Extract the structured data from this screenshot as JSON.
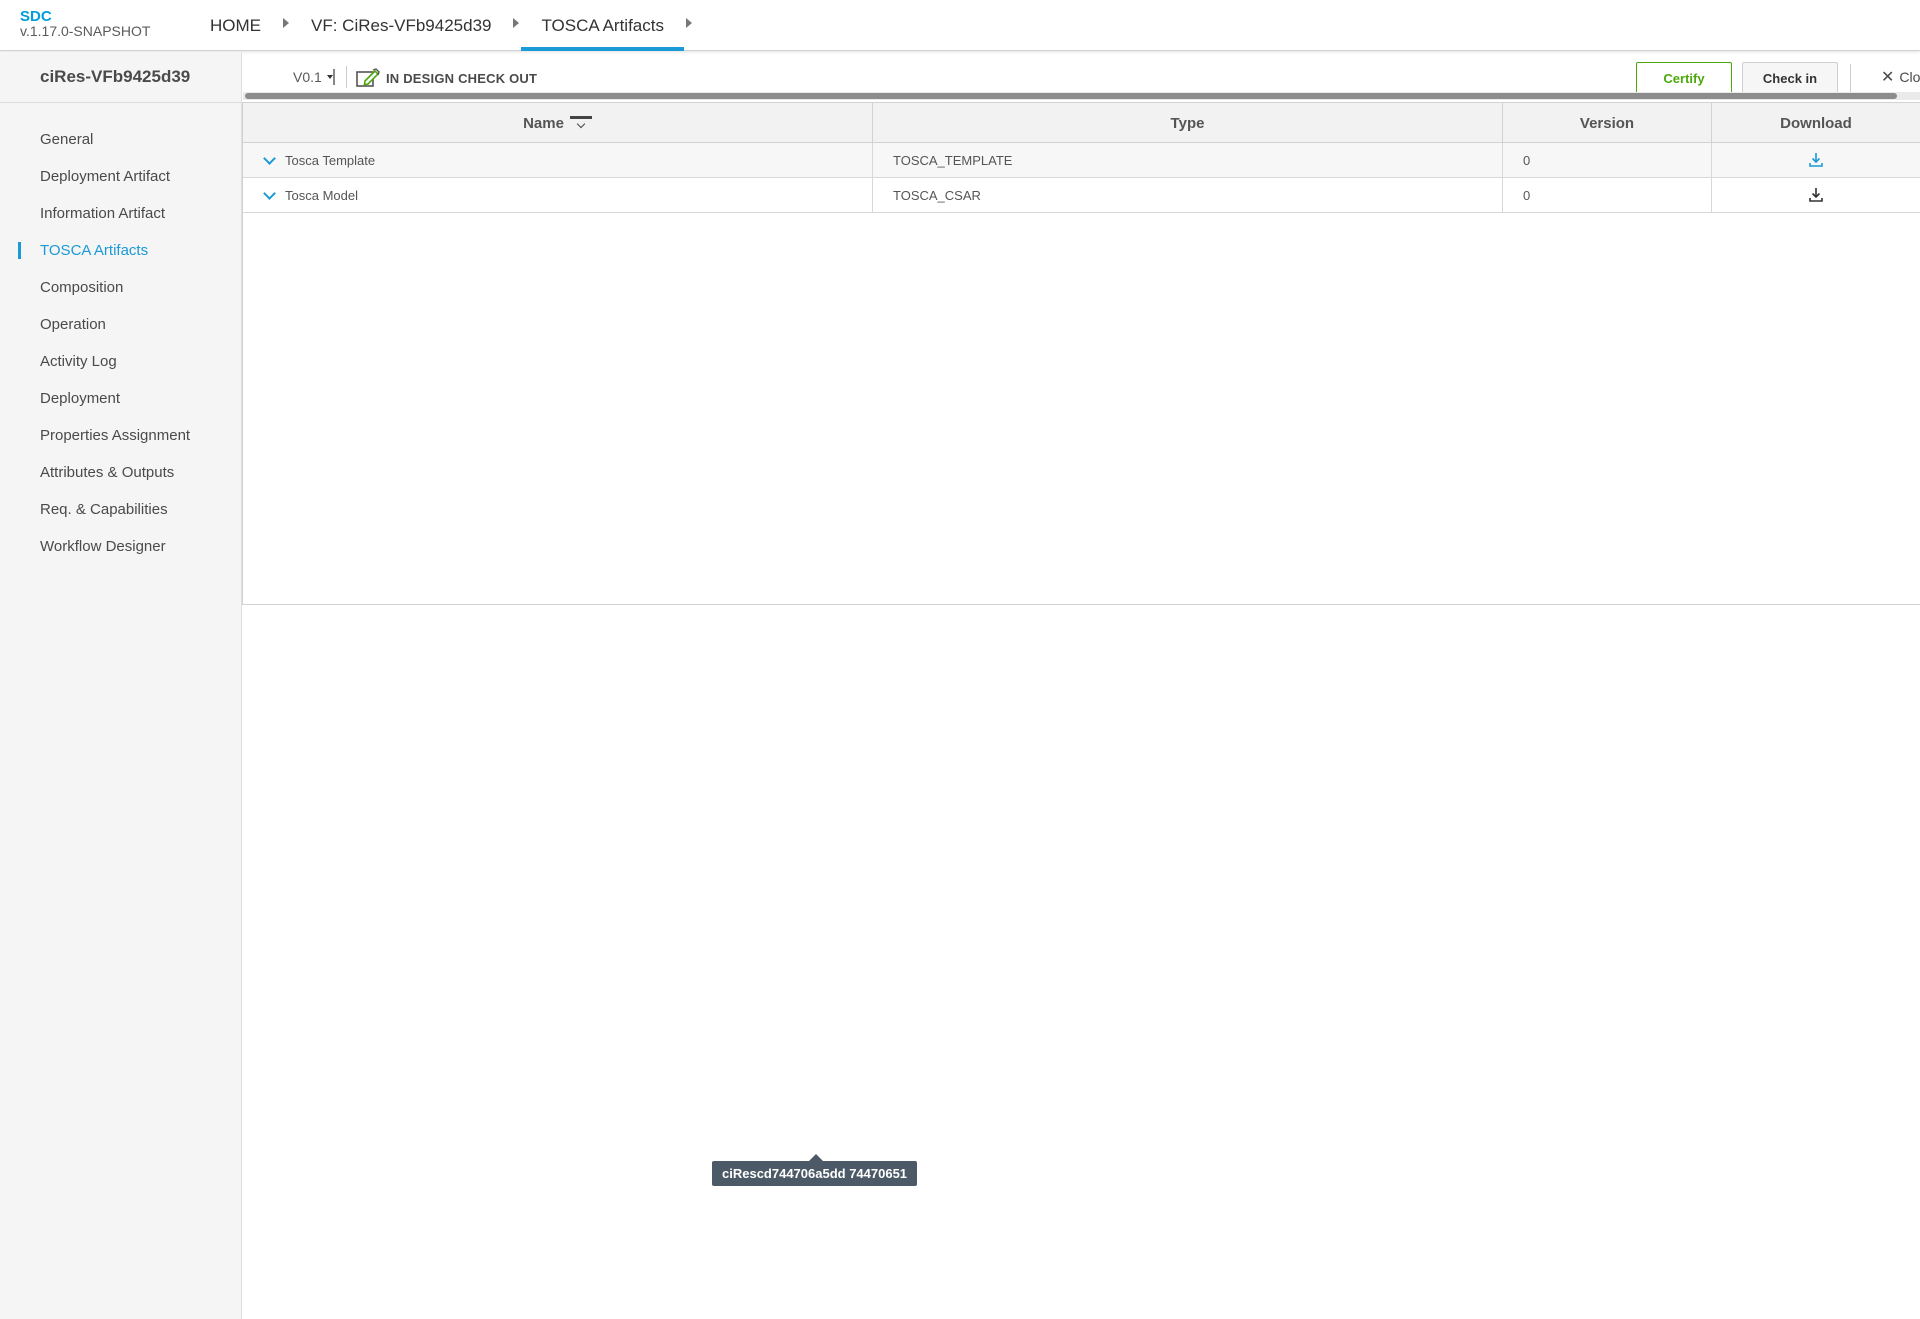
{
  "header": {
    "app_name": "SDC",
    "app_version": "v.1.17.0-SNAPSHOT",
    "breadcrumbs": [
      {
        "label": "HOME"
      },
      {
        "label": "VF: CiRes-VFb9425d39"
      },
      {
        "label": "TOSCA Artifacts",
        "active": true
      }
    ]
  },
  "sidebar": {
    "title": "ciRes-VFb9425d39",
    "items": [
      {
        "label": "General"
      },
      {
        "label": "Deployment Artifact"
      },
      {
        "label": "Information Artifact"
      },
      {
        "label": "TOSCA Artifacts",
        "active": true
      },
      {
        "label": "Composition"
      },
      {
        "label": "Operation"
      },
      {
        "label": "Activity Log"
      },
      {
        "label": "Deployment"
      },
      {
        "label": "Properties Assignment"
      },
      {
        "label": "Attributes & Outputs"
      },
      {
        "label": "Req. & Capabilities"
      },
      {
        "label": "Workflow Designer"
      }
    ]
  },
  "toolbar": {
    "version": "V0.1",
    "status": "IN DESIGN CHECK OUT",
    "certify_label": "Certify",
    "checkin_label": "Check in",
    "close_label": "Clo"
  },
  "table": {
    "columns": [
      "Name",
      "Type",
      "Version",
      "Download"
    ],
    "rows": [
      {
        "name": "Tosca Template",
        "type": "TOSCA_TEMPLATE",
        "version": "0",
        "download_icon": "download-icon",
        "download_color": "#1a9ad6"
      },
      {
        "name": "Tosca Model",
        "type": "TOSCA_CSAR",
        "version": "0",
        "download_icon": "download-icon",
        "download_color": "#333333"
      }
    ]
  },
  "tooltip": {
    "text": "ciRescd744706a5dd 74470651"
  },
  "colors": {
    "accent": "#1a9ad6",
    "certify": "#4ca90c",
    "tooltip_bg": "#4c5a67"
  }
}
